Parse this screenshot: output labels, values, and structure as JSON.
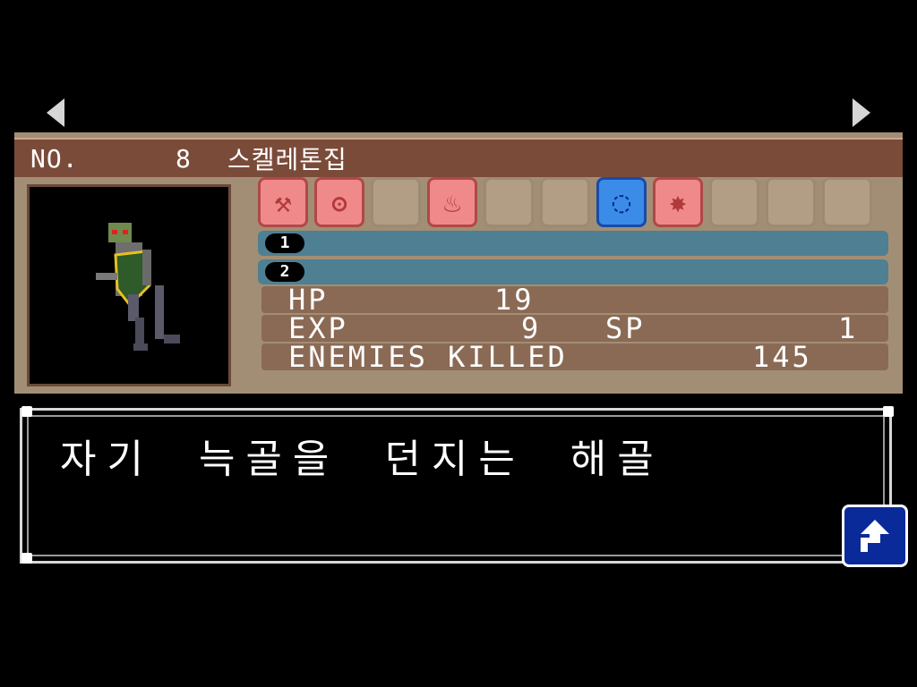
{
  "nav": {
    "prev_icon": "left-arrow-icon",
    "next_icon": "right-arrow-icon"
  },
  "header": {
    "no_label": "NO.",
    "number": "8",
    "name": "스켈레톤집"
  },
  "resistances": [
    {
      "icon": "hammer-icon",
      "state": "active",
      "glyph": "⚒"
    },
    {
      "icon": "whip-icon",
      "state": "active",
      "glyph": "ʘ"
    },
    {
      "icon": "empty",
      "state": "empty",
      "glyph": ""
    },
    {
      "icon": "fire-icon",
      "state": "active",
      "glyph": "♨"
    },
    {
      "icon": "empty",
      "state": "empty",
      "glyph": ""
    },
    {
      "icon": "empty",
      "state": "empty",
      "glyph": ""
    },
    {
      "icon": "ice-icon",
      "state": "weak",
      "glyph": "◌"
    },
    {
      "icon": "holy-icon",
      "state": "active",
      "glyph": "✸"
    },
    {
      "icon": "empty",
      "state": "empty",
      "glyph": ""
    },
    {
      "icon": "empty",
      "state": "empty",
      "glyph": ""
    },
    {
      "icon": "empty",
      "state": "empty",
      "glyph": ""
    }
  ],
  "drops": {
    "slot1": "1",
    "slot2": "2"
  },
  "stats": {
    "hp_label": "HP",
    "hp_value": "19",
    "exp_label": "EXP",
    "exp_value": "9",
    "sp_label": "SP",
    "sp_value": "1",
    "kills_label": "ENEMIES KILLED",
    "kills_value": "145"
  },
  "description": "자기 늑골을 던지는 해골",
  "colors": {
    "panel": "#a28e74",
    "header": "#7b4b3a",
    "slot_bar": "#4f7f93",
    "return_button": "#0a2a9a"
  }
}
